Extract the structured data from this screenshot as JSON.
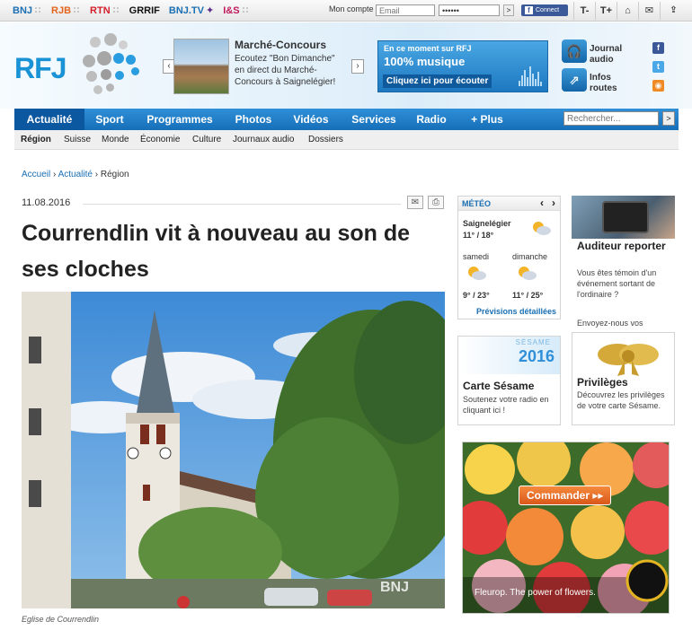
{
  "topbar": {
    "networks": [
      "BNJ",
      "RJB",
      "RTN",
      "GRRIF",
      "BNJ.TV",
      "I&S"
    ],
    "account_label": "Mon compte",
    "email_placeholder": "Email",
    "password_value": "••••••",
    "go_label": ">",
    "facebook_connect": "Connect",
    "text_smaller": "T-",
    "text_bigger": "T+",
    "home_icon": "home-icon",
    "mail_icon": "mail-icon"
  },
  "header": {
    "logo_text": "RFJ",
    "promo": {
      "title": "Marché-Concours",
      "text": "Ecoutez \"Bon Dimanche\" en direct du Marché-Concours à Saignelégier!",
      "prev": "‹",
      "next": "›"
    },
    "live": {
      "label": "En ce moment sur RFJ",
      "now": "100% musique",
      "cta": "Cliquez ici pour écouter"
    },
    "services": [
      {
        "label_line1": "Journal",
        "label_line2": "audio",
        "icon": "headphones-icon"
      },
      {
        "label_line1": "Infos",
        "label_line2": "routes",
        "icon": "road-icon"
      }
    ],
    "social": [
      "facebook-icon",
      "twitter-icon",
      "rss-icon"
    ]
  },
  "nav": {
    "items": [
      "Actualité",
      "Sport",
      "Programmes",
      "Photos",
      "Vidéos",
      "Services",
      "Radio",
      "+ Plus"
    ],
    "active": "Actualité",
    "search_placeholder": "Rechercher...",
    "search_go": ">"
  },
  "subnav": {
    "items": [
      "Région",
      "Suisse",
      "Monde",
      "Économie",
      "Culture",
      "Journaux audio",
      "Dossiers"
    ],
    "active": "Région"
  },
  "breadcrumb": {
    "home": "Accueil",
    "section": "Actualité",
    "current": "Région",
    "separator": "›"
  },
  "article": {
    "date": "11.08.2016",
    "title": "Courrendlin vit à nouveau au son de ses cloches",
    "caption": "Eglise de Courrendlin",
    "watermark": "BNJ"
  },
  "meteo": {
    "header": "MÉTÉO",
    "prev": "‹",
    "next": "›",
    "location": "Saignelégier",
    "today_temp": "11° / 18°",
    "day1_name": "samedi",
    "day1_temp": "9° / 23°",
    "day2_name": "dimanche",
    "day2_temp": "11° / 25°",
    "details_link": "Prévisions détaillées"
  },
  "auditeur": {
    "title": "Auditeur reporter",
    "text": "Vous êtes témoin d'un événement sortant de l'ordinaire ?",
    "text2": "Envoyez-nous vos"
  },
  "sesame": {
    "banner": "SÉSAME",
    "year": "2016",
    "title": "Carte Sésame",
    "text": "Soutenez votre radio en cliquant ici !"
  },
  "privileges": {
    "title": "Privilèges",
    "text": "Découvrez les privilèges de votre carte Sésame."
  },
  "ad": {
    "button": "Commander ▸▸",
    "tagline": "Fleurop. The power of flowers."
  },
  "colors": {
    "brand_blue": "#1a93d6",
    "nav_blue": "#166fb8",
    "nav_active": "#0b57a0"
  }
}
